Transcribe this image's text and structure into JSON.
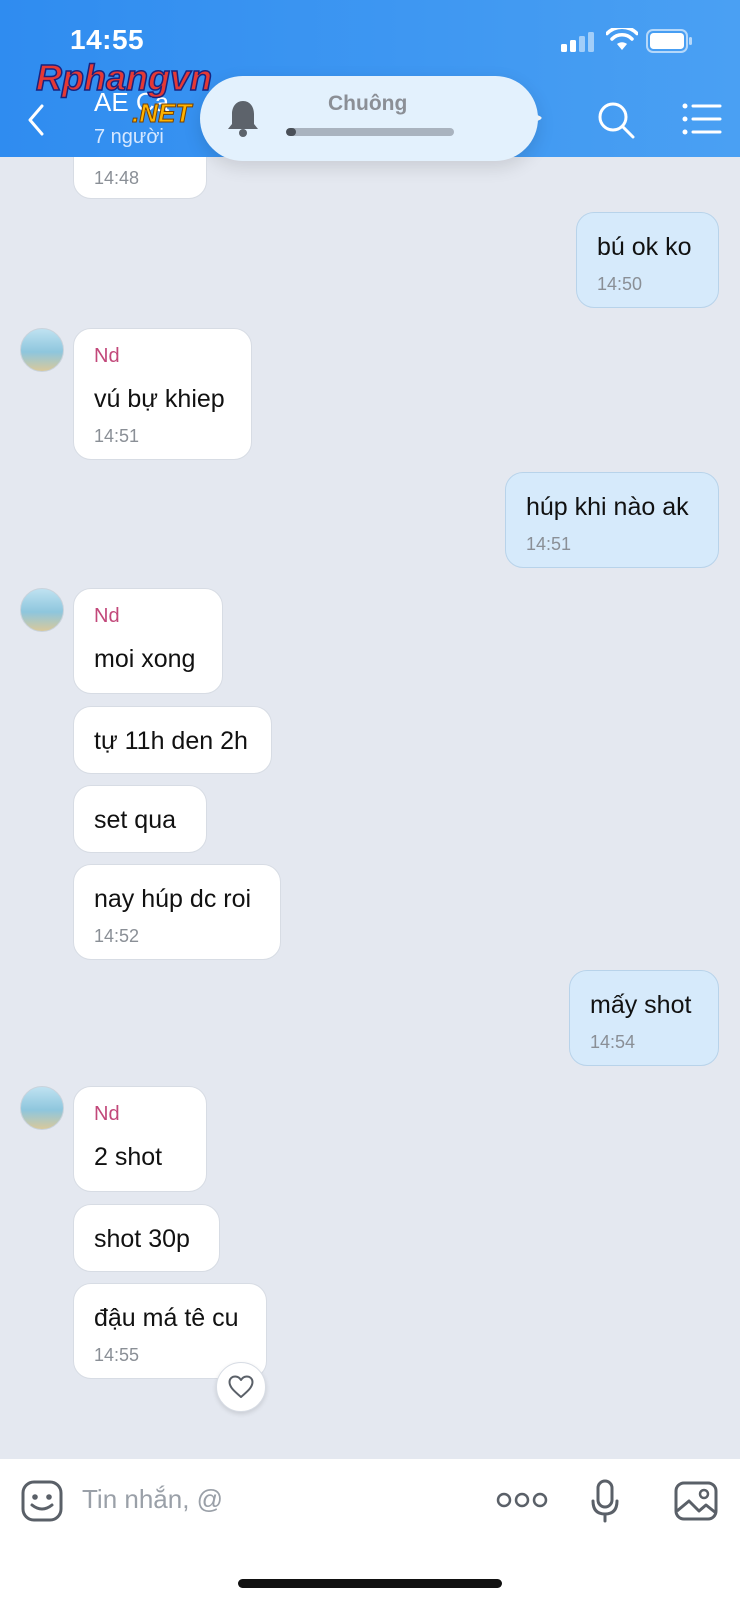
{
  "status_bar": {
    "time": "14:55"
  },
  "header": {
    "title": "AE Ca",
    "subtitle": "7 người"
  },
  "watermark": {
    "main": "Rphangvn",
    "suffix": ".NET"
  },
  "ringer": {
    "label": "Chuông",
    "level": 0.06
  },
  "messages": {
    "m0_time": "14:48",
    "m1_text": "bú ok ko",
    "m1_time": "14:50",
    "m2_sender": "Nd",
    "m2_text": "vú bự khiep",
    "m2_time": "14:51",
    "m3_text": "húp khi nào ak",
    "m3_time": "14:51",
    "m4_sender": "Nd",
    "m4_text": "moi xong",
    "m5_text": "tự 11h den 2h",
    "m6_text": "set qua",
    "m7_text": "nay húp dc roi",
    "m7_time": "14:52",
    "m8_text": "mấy shot",
    "m8_time": "14:54",
    "m9_sender": "Nd",
    "m9_text": "2 shot",
    "m10_text": "shot 30p",
    "m11_text": "đậu má tê cu",
    "m11_time": "14:55"
  },
  "input": {
    "placeholder": "Tin nhắn, @"
  },
  "icons": [
    "back-icon",
    "video-call-icon",
    "search-icon",
    "menu-icon",
    "bell-icon",
    "emoji-icon",
    "more-icon",
    "microphone-icon",
    "image-icon",
    "heart-icon"
  ]
}
